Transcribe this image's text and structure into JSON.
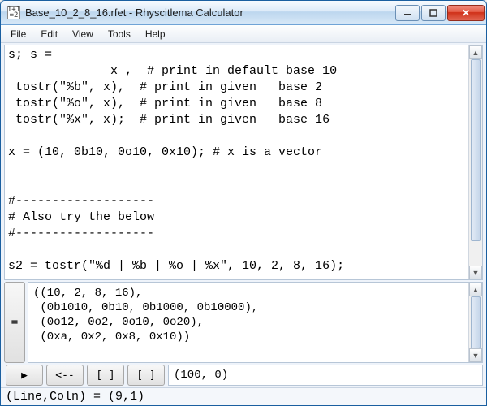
{
  "window": {
    "title": "Base_10_2_8_16.rfet - Rhyscitlema Calculator",
    "app_icon_top": "1+1",
    "app_icon_bot": "=2"
  },
  "menu": {
    "file": "File",
    "edit": "Edit",
    "view": "View",
    "tools": "Tools",
    "help": "Help"
  },
  "editor": {
    "content": "s; s =\n              x ,  # print in default base 10\n tostr(\"%b\", x),  # print in given   base 2\n tostr(\"%o\", x),  # print in given   base 8\n tostr(\"%x\", x);  # print in given   base 16\n\nx = (10, 0b10, 0o10, 0x10); # x is a vector\n\n\n#-------------------\n# Also try the below\n#-------------------\n\ns2 = tostr(\"%d | %b | %o | %x\", 10, 2, 8, 16);\n"
  },
  "output": {
    "eq_label": "=",
    "content": "((10, 2, 8, 16),\n (0b1010, 0b10, 0b1000, 0b10000),\n (0o12, 0o2, 0o10, 0o20),\n (0xa, 0x2, 0x8, 0x10))"
  },
  "toolbar": {
    "run": "▶",
    "back": "<--",
    "brk1": "[ ]",
    "brk2": "[ ]",
    "display": "(100, 0)"
  },
  "status": {
    "text": "(Line,Coln) = (9,1)"
  }
}
